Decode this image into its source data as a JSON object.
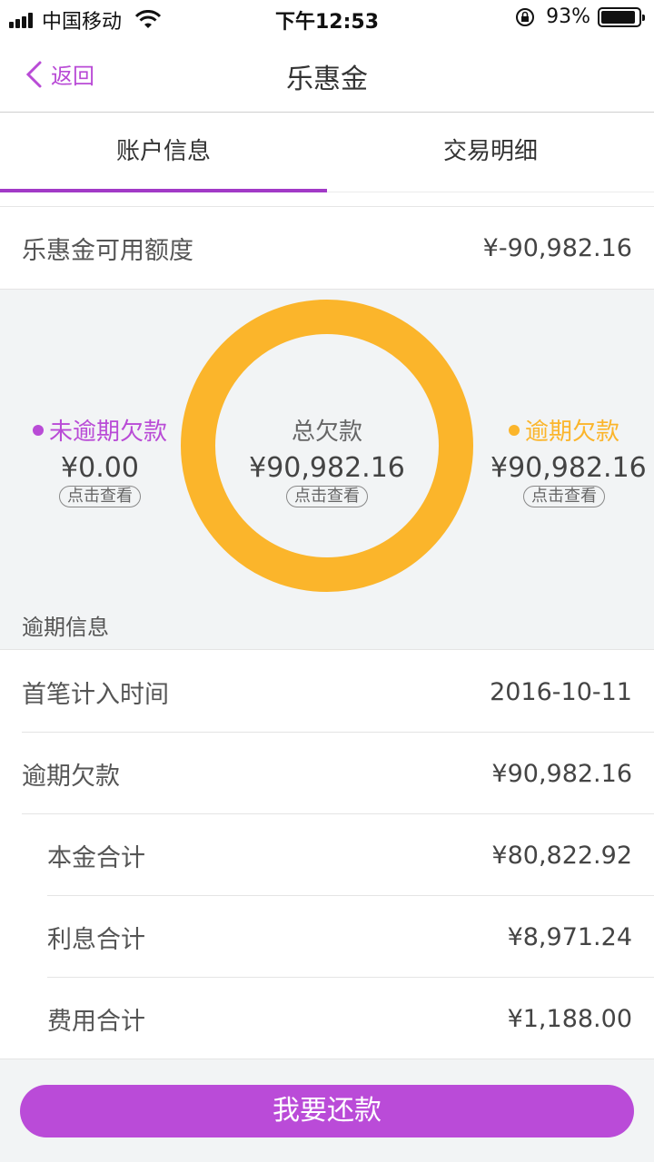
{
  "status_bar": {
    "carrier": "中国移动",
    "time": "下午12:53",
    "battery": "93%",
    "battery_level": 0.93
  },
  "nav": {
    "back_label": "返回",
    "title": "乐惠金"
  },
  "tabs": [
    {
      "label": "账户信息",
      "active": true
    },
    {
      "label": "交易明细",
      "active": false
    }
  ],
  "available": {
    "label": "乐惠金可用额度",
    "value": "¥-90,982.16"
  },
  "summary": {
    "not_overdue": {
      "label": "未逾期欠款",
      "value": "¥0.00",
      "link": "点击查看",
      "color": "#b94bd6"
    },
    "total": {
      "label": "总欠款",
      "value": "¥90,982.16",
      "link": "点击查看"
    },
    "overdue": {
      "label": "逾期欠款",
      "value": "¥90,982.16",
      "link": "点击查看",
      "color": "#fbb52b"
    },
    "ring_color": "#fbb52b",
    "overdue_fraction": 1.0
  },
  "overdue_info": {
    "section_label": "逾期信息",
    "rows": [
      {
        "label": "首笔计入时间",
        "value": "2016-10-11"
      },
      {
        "label": "逾期欠款",
        "value": "¥90,982.16"
      },
      {
        "label": "本金合计",
        "value": "¥80,822.92"
      },
      {
        "label": "利息合计",
        "value": "¥8,971.24"
      },
      {
        "label": "费用合计",
        "value": "¥1,188.00"
      }
    ]
  },
  "pay_button": {
    "label": "我要还款",
    "color": "#ba4bd8"
  }
}
